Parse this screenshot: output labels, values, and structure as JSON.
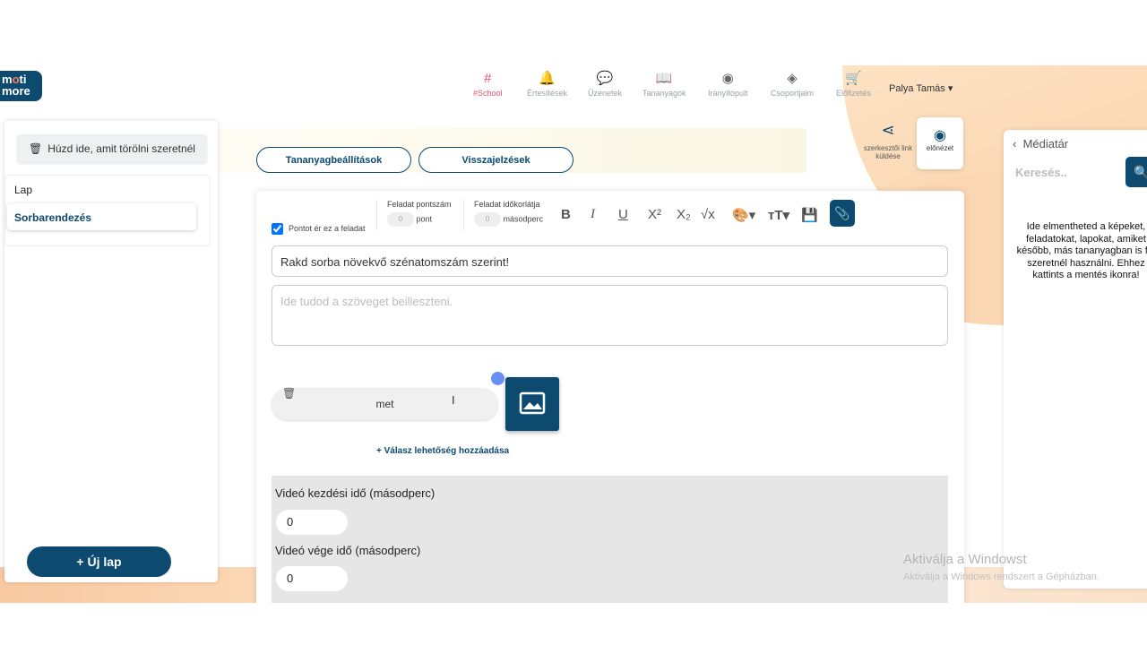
{
  "logo": {
    "line1a": "m",
    "line1b": "o",
    "line1c": "ti",
    "line2": "more"
  },
  "nav": [
    {
      "icon": "#",
      "label": "#School",
      "active": true
    },
    {
      "icon": "🔔",
      "label": "Értesítések"
    },
    {
      "icon": "💬",
      "label": "Üzenetek"
    },
    {
      "icon": "📖",
      "label": "Tananyagok"
    },
    {
      "icon": "◉",
      "label": "Irányítópult"
    },
    {
      "icon": "◈",
      "label": "Csoportjaim"
    },
    {
      "icon": "🛒",
      "label": "Előfizetés"
    }
  ],
  "user": "Palya Tamás ▾",
  "left": {
    "trash": "Húzd ide, amit törölni szeretnél",
    "item1": "Lap",
    "item2": "Sorbarendezés",
    "new_page": "+ Új lap"
  },
  "tabs": {
    "settings": "Tananyagbeállítások",
    "feedback": "Visszajelzések"
  },
  "share": {
    "label": "szerkesztői link küldése"
  },
  "preview": {
    "label": "előnézet"
  },
  "toolbar": {
    "points_check": "Pontot ér ez a feladat",
    "points_title": "Feladat pontszám",
    "points_val": "0",
    "points_unit": "pont",
    "time_title": "Feladat időkorlátja",
    "time_val": "0",
    "time_unit": "másodperc"
  },
  "task": {
    "title_value": "Rakd sorba növekvő szénatomszám szerint!",
    "text_placeholder": "Ide tudod a szöveget beilleszteni."
  },
  "answer": {
    "value": "met"
  },
  "add_answer": "+ Válasz lehetőség hozzáadása",
  "video": {
    "start_label": "Videó kezdési idő (másodperc)",
    "start_value": "0",
    "end_label": "Videó vége idő (másodperc)",
    "end_value": "0"
  },
  "media": {
    "title": "Médiatár",
    "search_placeholder": "Keresés..",
    "info": "Ide elmentheted a képeket, feladatokat, lapokat, amiket később, más tananyagban is fel szeretnél használni. Ehhez kattints a mentés ikonra!"
  },
  "windows": {
    "line1": "Aktiválja a Windowst",
    "line2": "Aktiválja a Windows rendszert a Gépházban."
  }
}
